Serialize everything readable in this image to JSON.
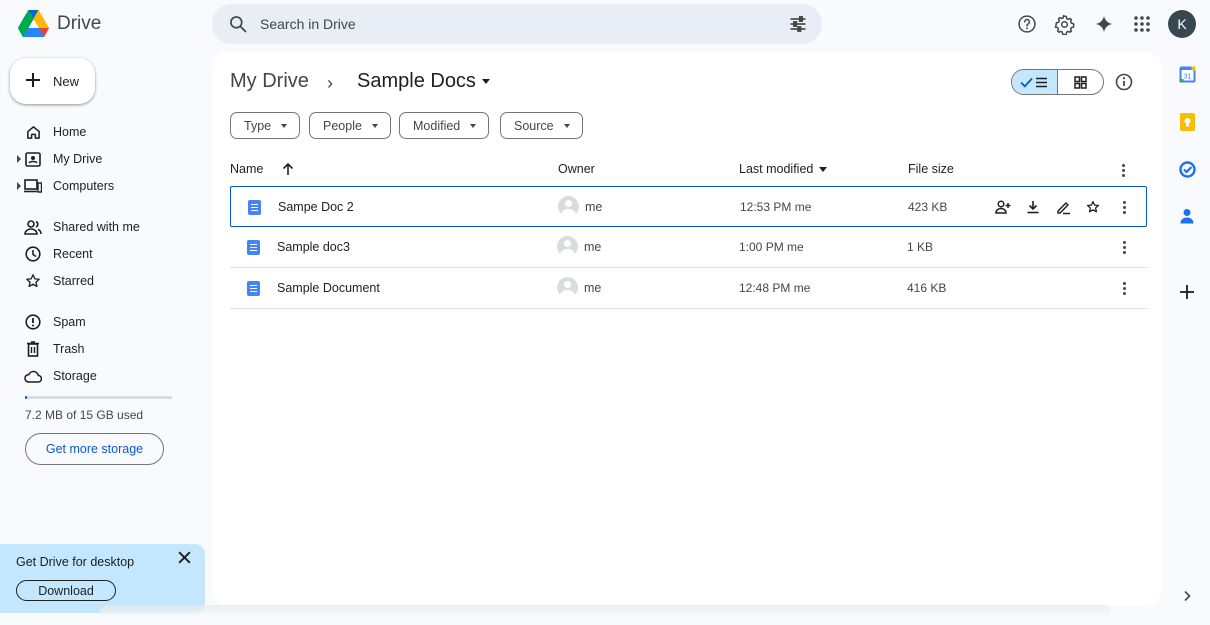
{
  "app": {
    "name": "Drive"
  },
  "search": {
    "placeholder": "Search in Drive"
  },
  "header_icons": [
    "help-icon",
    "settings-icon",
    "gemini-sparkle-icon",
    "apps-grid-icon"
  ],
  "account": {
    "initial": "K"
  },
  "new_button": {
    "label": "New"
  },
  "sidebar": {
    "items": [
      {
        "label": "Home",
        "icon": "home-icon"
      },
      {
        "label": "My Drive",
        "icon": "my-drive-icon"
      },
      {
        "label": "Computers",
        "icon": "computers-icon"
      },
      {
        "label": "Shared with me",
        "icon": "shared-icon"
      },
      {
        "label": "Recent",
        "icon": "clock-icon"
      },
      {
        "label": "Starred",
        "icon": "star-icon"
      },
      {
        "label": "Spam",
        "icon": "spam-icon"
      },
      {
        "label": "Trash",
        "icon": "trash-icon"
      },
      {
        "label": "Storage",
        "icon": "cloud-icon"
      }
    ],
    "storage_text": "7.2 MB of 15 GB used",
    "storage_used_fraction": 0.0005,
    "get_storage_label": "Get more storage"
  },
  "promo": {
    "title": "Get Drive for desktop",
    "button": "Download"
  },
  "breadcrumb": {
    "parent": "My Drive",
    "separator": "›",
    "current": "Sample Docs"
  },
  "filters": [
    "Type",
    "People",
    "Modified",
    "Source"
  ],
  "table": {
    "headers": {
      "name": "Name",
      "owner": "Owner",
      "modified": "Last modified",
      "size": "File size"
    },
    "rows": [
      {
        "name": "Sampe Doc 2",
        "owner": "me",
        "modified": "12:53 PM  me",
        "size": "423 KB",
        "selected": true
      },
      {
        "name": "Sample doc3",
        "owner": "me",
        "modified": "1:00 PM  me",
        "size": "1 KB",
        "selected": false
      },
      {
        "name": "Sample Document",
        "owner": "me",
        "modified": "12:48 PM  me",
        "size": "416 KB",
        "selected": false
      }
    ]
  },
  "colors": {
    "accent": "#0b57d0",
    "selection_bg": "#c2e7ff",
    "page_bg": "#f8fafd",
    "search_bg": "#e9eef6"
  }
}
